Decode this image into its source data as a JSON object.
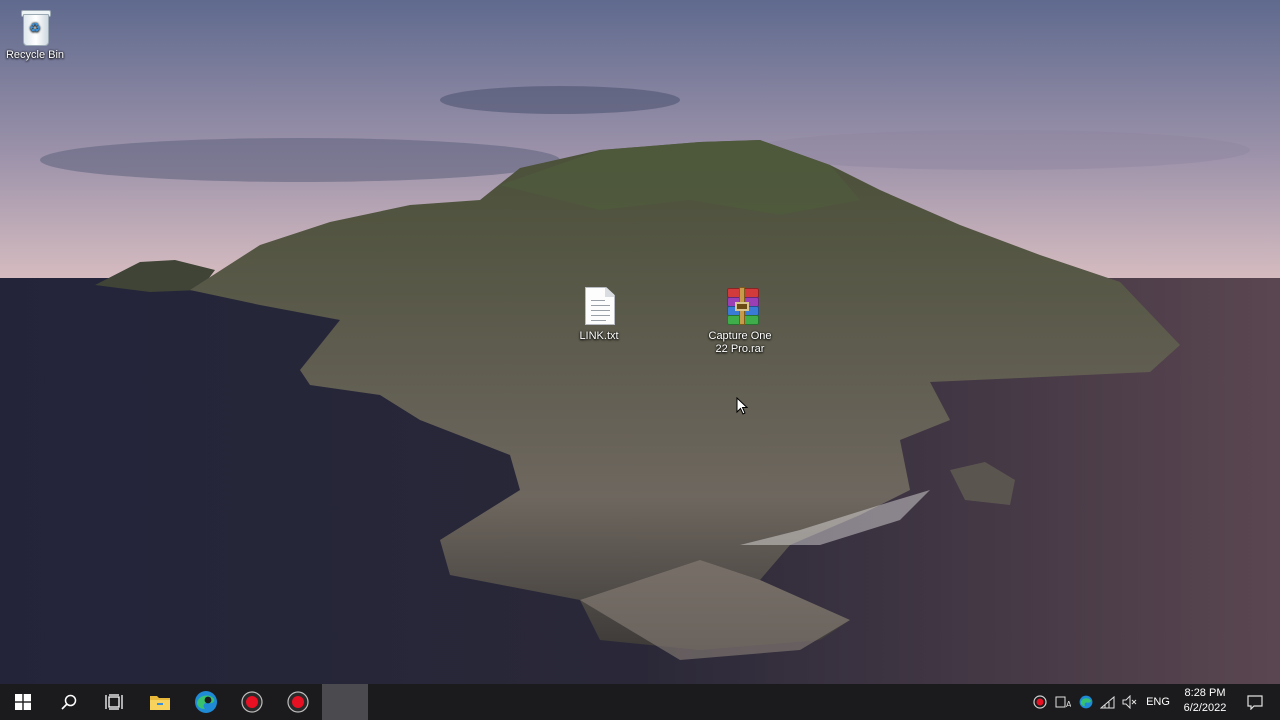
{
  "desktop": {
    "icons": [
      {
        "label": "Recycle Bin"
      },
      {
        "label": "LINK.txt"
      },
      {
        "label": "Capture One 22 Pro.rar"
      }
    ]
  },
  "taskbar": {
    "buttons": [
      "windows-logo-icon",
      "search-icon",
      "task-view-icon",
      "file-explorer-icon",
      "edge-icon",
      "record-icon",
      "record-icon",
      "active-app"
    ],
    "tray": {
      "language": "ENG",
      "time": "8:28 PM",
      "date": "6/2/2022"
    }
  },
  "colors": {
    "taskbar": "#1b1b1d",
    "accent_red": "#e81123"
  }
}
